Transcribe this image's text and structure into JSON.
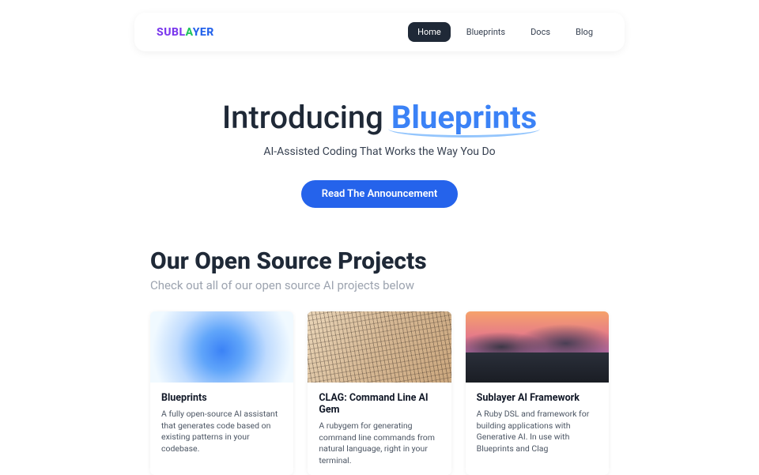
{
  "nav": {
    "logo_parts": {
      "sub": "SUBL",
      "a": "A",
      "yer": "YER"
    },
    "items": [
      {
        "label": "Home",
        "active": true
      },
      {
        "label": "Blueprints",
        "active": false
      },
      {
        "label": "Docs",
        "active": false
      },
      {
        "label": "Blog",
        "active": false
      }
    ]
  },
  "hero": {
    "title_prefix": "Introducing ",
    "title_accent": "Blueprints",
    "subtitle": "AI-Assisted Coding That Works the Way You Do",
    "cta": "Read The Announcement"
  },
  "projects": {
    "heading": "Our Open Source Projects",
    "subheading": "Check out all of our open source AI projects below",
    "cards": [
      {
        "title": "Blueprints",
        "desc": "A fully open-source AI assistant that generates code based on existing patterns in your codebase."
      },
      {
        "title": "CLAG: Command Line AI Gem",
        "desc": "A rubygem for generating command line commands from natural language, right in your terminal."
      },
      {
        "title": "Sublayer AI Framework",
        "desc": "A Ruby DSL and framework for building applications with Generative AI. In use with Blueprints and Clag"
      }
    ]
  }
}
